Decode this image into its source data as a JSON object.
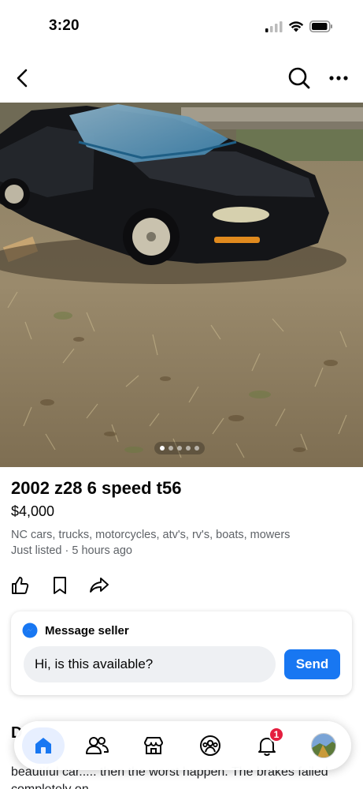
{
  "status": {
    "time": "3:20"
  },
  "photo": {
    "count": 5,
    "active_index": 0
  },
  "listing": {
    "title": "2002 z28 6 speed t56",
    "price": "$4,000",
    "group": "NC cars, trucks, motorcycles, atv's, rv's, boats, mowers",
    "posted": "Just listed · 5 hours ago"
  },
  "actions": [
    "like-icon",
    "save-icon",
    "share-icon"
  ],
  "message": {
    "title": "Message seller",
    "input_value": "Hi, is this available?",
    "send_label": "Send"
  },
  "description": {
    "heading": "D",
    "text": "beautiful car..... then the worst happen. The brakes failed completely on... "
  },
  "tabs": {
    "items": [
      "home-icon",
      "friends-icon",
      "marketplace-icon",
      "groups-icon",
      "notifications-icon",
      "profile-avatar"
    ],
    "notification_count": "1"
  },
  "colors": {
    "accent": "#1877f2",
    "badge": "#e41e3f",
    "text_secondary": "#5f6368"
  }
}
